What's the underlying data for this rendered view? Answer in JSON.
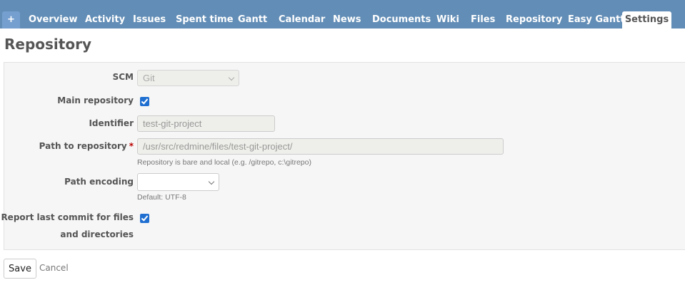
{
  "nav": {
    "plus_label": "+",
    "tabs": [
      {
        "label": "Overview"
      },
      {
        "label": "Activity"
      },
      {
        "label": "Issues"
      },
      {
        "label": "Spent time"
      },
      {
        "label": "Gantt"
      },
      {
        "label": "Calendar"
      },
      {
        "label": "News"
      },
      {
        "label": "Documents"
      },
      {
        "label": "Wiki"
      },
      {
        "label": "Files"
      },
      {
        "label": "Repository"
      },
      {
        "label": "Easy Gantt"
      },
      {
        "label": "Settings",
        "selected": true
      }
    ]
  },
  "page": {
    "title": "Repository"
  },
  "form": {
    "scm": {
      "label": "SCM",
      "value": "Git",
      "disabled": true
    },
    "main_repository": {
      "label": "Main repository",
      "checked": true
    },
    "identifier": {
      "label": "Identifier",
      "value": "test-git-project",
      "disabled": true
    },
    "path": {
      "label": "Path to repository",
      "required_mark": "*",
      "value": "/usr/src/redmine/files/test-git-project/",
      "hint": "Repository is bare and local (e.g. /gitrepo, c:\\gitrepo)",
      "disabled": true
    },
    "path_encoding": {
      "label": "Path encoding",
      "value": "",
      "hint": "Default: UTF-8"
    },
    "report_last_commit": {
      "label_line1": "Report last commit for files",
      "label_line2": "and directories",
      "checked": true
    }
  },
  "actions": {
    "save_label": "Save",
    "cancel_label": "Cancel"
  },
  "colors": {
    "topbar": "#628db6",
    "checkbox": "#1f6fd1",
    "required": "#bb0000"
  }
}
